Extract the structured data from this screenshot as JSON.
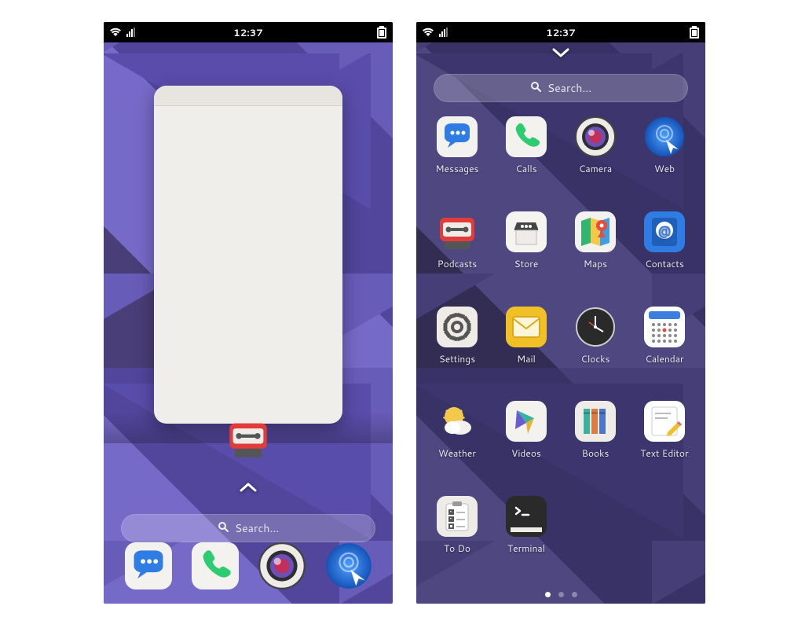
{
  "status": {
    "time": "12:37"
  },
  "search": {
    "placeholder": "Search..."
  },
  "overview": {
    "running_app_icon": "podcasts"
  },
  "dock": [
    {
      "id": "messages",
      "label": "Messages"
    },
    {
      "id": "calls",
      "label": "Calls"
    },
    {
      "id": "camera",
      "label": "Camera"
    },
    {
      "id": "web",
      "label": "Web"
    }
  ],
  "apps": [
    {
      "id": "messages",
      "label": "Messages"
    },
    {
      "id": "calls",
      "label": "Calls"
    },
    {
      "id": "camera",
      "label": "Camera"
    },
    {
      "id": "web",
      "label": "Web"
    },
    {
      "id": "podcasts",
      "label": "Podcasts"
    },
    {
      "id": "store",
      "label": "Store"
    },
    {
      "id": "maps",
      "label": "Maps"
    },
    {
      "id": "contacts",
      "label": "Contacts"
    },
    {
      "id": "settings",
      "label": "Settings"
    },
    {
      "id": "mail",
      "label": "Mail"
    },
    {
      "id": "clocks",
      "label": "Clocks"
    },
    {
      "id": "calendar",
      "label": "Calendar"
    },
    {
      "id": "weather",
      "label": "Weather"
    },
    {
      "id": "videos",
      "label": "Videos"
    },
    {
      "id": "books",
      "label": "Books"
    },
    {
      "id": "texteditor",
      "label": "Text Editor"
    },
    {
      "id": "todo",
      "label": "To Do"
    },
    {
      "id": "terminal",
      "label": "Terminal"
    }
  ],
  "pager": {
    "pages": 3,
    "active": 0
  }
}
